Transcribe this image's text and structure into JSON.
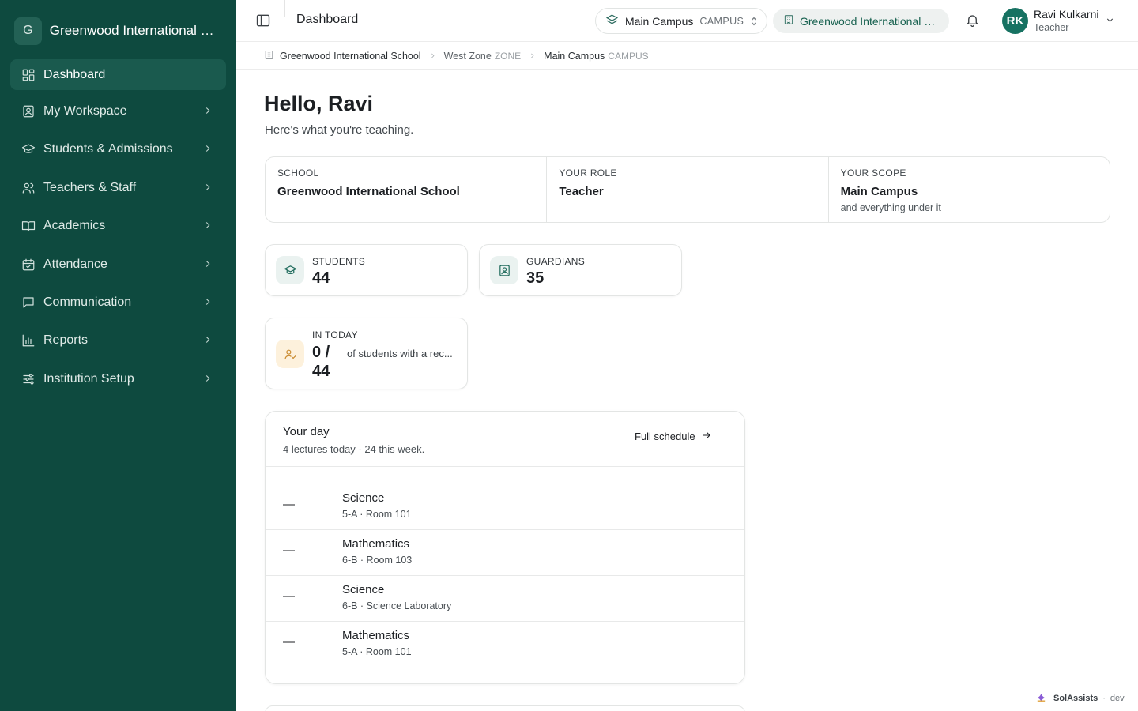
{
  "sidebar": {
    "brand_initial": "G",
    "brand_name": "Greenwood International Sc...",
    "items": [
      {
        "label": "Dashboard",
        "icon": "dashboard-icon"
      },
      {
        "label": "My Workspace",
        "icon": "workspace-icon"
      },
      {
        "label": "Students & Admissions",
        "icon": "graduation-cap-icon"
      },
      {
        "label": "Teachers & Staff",
        "icon": "users-icon"
      },
      {
        "label": "Academics",
        "icon": "book-icon"
      },
      {
        "label": "Attendance",
        "icon": "calendar-check-icon"
      },
      {
        "label": "Communication",
        "icon": "message-icon"
      },
      {
        "label": "Reports",
        "icon": "bar-chart-icon"
      },
      {
        "label": "Institution Setup",
        "icon": "sliders-icon"
      }
    ]
  },
  "topbar": {
    "page_title": "Dashboard",
    "campus_name": "Main Campus",
    "campus_type": "CAMPUS",
    "school_pill": "Greenwood International S...",
    "user_initials": "RK",
    "user_name": "Ravi Kulkarni",
    "user_role": "Teacher"
  },
  "breadcrumb": {
    "school": "Greenwood International School",
    "zone_name": "West Zone",
    "zone_tag": "ZONE",
    "campus_name": "Main Campus",
    "campus_tag": "CAMPUS"
  },
  "greeting": {
    "title": "Hello, Ravi",
    "subtitle": "Here's what you're teaching."
  },
  "info": {
    "school_label": "SCHOOL",
    "school_value": "Greenwood International School",
    "role_label": "YOUR ROLE",
    "role_value": "Teacher",
    "scope_label": "YOUR SCOPE",
    "scope_value": "Main Campus",
    "scope_sub": "and everything under it"
  },
  "stats": {
    "students_label": "STUDENTS",
    "students_value": "44",
    "guardians_label": "GUARDIANS",
    "guardians_value": "35",
    "intoday_label": "IN TODAY",
    "intoday_value_line1": "0 /",
    "intoday_value_line2": "44",
    "intoday_desc": "of students with a rec..."
  },
  "schedule": {
    "title": "Your day",
    "subtitle": "4 lectures today · 24 this week.",
    "link": "Full schedule",
    "lectures": [
      {
        "time": "—",
        "subject": "Science",
        "detail": "5-A · Room 101"
      },
      {
        "time": "—",
        "subject": "Mathematics",
        "detail": "6-B · Room 103"
      },
      {
        "time": "—",
        "subject": "Science",
        "detail": "6-B · Science Laboratory"
      },
      {
        "time": "—",
        "subject": "Mathematics",
        "detail": "5-A · Room 101"
      }
    ]
  },
  "footer": {
    "brand": "SolAssists",
    "sep": "·",
    "env": "dev"
  },
  "colors": {
    "sidebar_bg": "#0e4a3f",
    "sidebar_active": "#1a5a4e",
    "accent": "#177262",
    "intoday_icon_bg": "#fdf1dc"
  }
}
